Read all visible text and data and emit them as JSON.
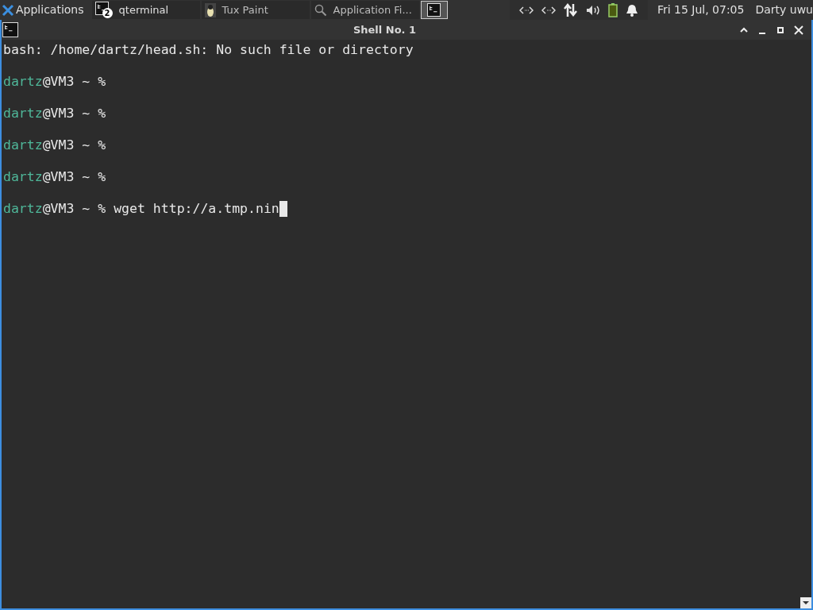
{
  "panel": {
    "menu_label": "Applications",
    "tasks": [
      {
        "kind": "terminal",
        "label": "qterminal",
        "badge": "2",
        "selected": false
      },
      {
        "kind": "paint",
        "label": "Tux Paint",
        "selected": false
      },
      {
        "kind": "search",
        "label": "Application Fi...",
        "selected": false
      },
      {
        "kind": "terminal",
        "selected": true
      }
    ],
    "clock": "Fri 15 Jul, 07:05",
    "user": "Darty uwu"
  },
  "window": {
    "title": "Shell No. 1"
  },
  "terminal": {
    "lines": [
      {
        "kind": "output",
        "text": "bash: /home/dartz/head.sh: No such file or directory"
      },
      {
        "kind": "prompt",
        "user": "dartz",
        "host": "@VM3 ~ %",
        "cursor": false
      },
      {
        "kind": "prompt",
        "user": "dartz",
        "host": "@VM3 ~ %",
        "cursor": false
      },
      {
        "kind": "prompt",
        "user": "dartz",
        "host": "@VM3 ~ %",
        "cursor": false
      },
      {
        "kind": "prompt",
        "user": "dartz",
        "host": "@VM3 ~ %",
        "cursor": false
      },
      {
        "kind": "prompt",
        "user": "dartz",
        "host": "@VM3 ~ %",
        "command": "wget http://a.tmp.nin",
        "cursor": true
      }
    ]
  }
}
